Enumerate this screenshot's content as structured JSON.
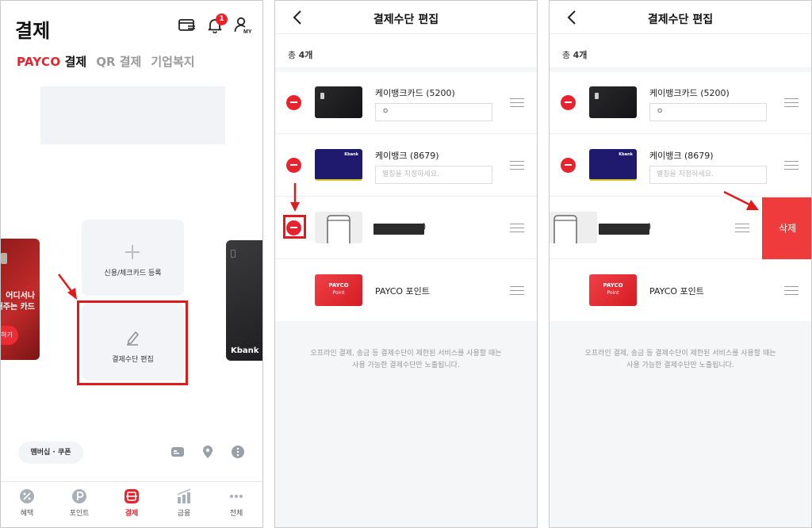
{
  "colors": {
    "accent": "#e8232d",
    "highlight": "#e11b1b",
    "delete_bg": "#ef3b3b",
    "footer_bg": "#f5f6f8"
  },
  "panel1": {
    "title": "결제",
    "header_icons": [
      "card-list-icon",
      "bell-icon",
      "my-account-icon"
    ],
    "notification_count": "1",
    "my_label": "MY",
    "tabs": {
      "brand": "PAYCO",
      "active_suffix": " 결제",
      "qr": "QR 결제",
      "welfare": "기업복지"
    },
    "left_card_text_1": "어디서나",
    "left_card_text_2": "해주는 카드",
    "left_card_button": "급하기",
    "right_card_brand": "Kbank",
    "add_card_label": "신용/체크카드 등록",
    "edit_payment_label": "결제수단 편집",
    "coupon_label": "멤버십 · 쿠폰",
    "bottom_nav": [
      {
        "label": "혜택",
        "icon": "percent-icon"
      },
      {
        "label": "포인트",
        "icon": "point-icon"
      },
      {
        "label": "결제",
        "icon": "payment-icon"
      },
      {
        "label": "금융",
        "icon": "chart-icon"
      },
      {
        "label": "전체",
        "icon": "more-icon"
      }
    ]
  },
  "edit": {
    "title": "결제수단 편집",
    "total_prefix": "총 ",
    "total_count": "4개",
    "items": [
      {
        "name": "케이뱅크카드 (5200)",
        "nickname": "ㅇ"
      },
      {
        "name": "케이뱅크 (8679)",
        "placeholder": "별칭을 지정하세요."
      },
      {
        "name_tail": ")"
      },
      {
        "name": "PAYCO 포인트"
      }
    ],
    "kbank_mini": "Kbank",
    "payco_card_line1": "PAYCO",
    "payco_card_line2": "Point",
    "footer_line1": "오프라인 결제, 송금 등 결제수단이 제한된 서비스를 사용할 때는",
    "footer_line2": "사용 가능한 결제수단만 노출됩니다.",
    "delete_label": "삭제"
  }
}
